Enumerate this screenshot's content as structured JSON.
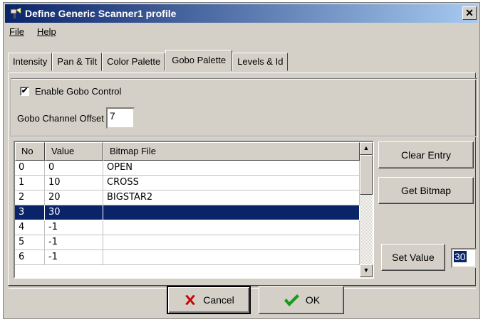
{
  "window": {
    "title": "Define Generic Scanner1 profile",
    "close_glyph": "✕"
  },
  "menu": {
    "file": "File",
    "help": "Help"
  },
  "tabs": [
    "Intensity",
    "Pan & Tilt",
    "Color Palette",
    "Gobo Palette",
    "Levels & Id"
  ],
  "active_tab": "Gobo Palette",
  "gobo": {
    "enable_label": "Enable Gobo Control",
    "enable_checked": true,
    "offset_label": "Gobo Channel Offset",
    "offset_value": "7"
  },
  "grid": {
    "columns": [
      "No",
      "Value",
      "Bitmap File"
    ],
    "rows": [
      {
        "no": "0",
        "value": "0",
        "bitmap": "OPEN"
      },
      {
        "no": "1",
        "value": "10",
        "bitmap": "CROSS"
      },
      {
        "no": "2",
        "value": "20",
        "bitmap": "BIGSTAR2"
      },
      {
        "no": "3",
        "value": "30",
        "bitmap": "",
        "selected": true
      },
      {
        "no": "4",
        "value": "-1",
        "bitmap": ""
      },
      {
        "no": "5",
        "value": "-1",
        "bitmap": ""
      },
      {
        "no": "6",
        "value": "-1",
        "bitmap": ""
      }
    ]
  },
  "buttons": {
    "clear_entry": "Clear Entry",
    "get_bitmap": "Get Bitmap",
    "set_value": "Set Value",
    "set_value_input": "30",
    "cancel": "Cancel",
    "ok": "OK"
  },
  "colors": {
    "title_start": "#0a246a",
    "selection": "#0a246a",
    "cancel_icon": "#cc0000",
    "ok_icon": "#1a9a1a"
  }
}
